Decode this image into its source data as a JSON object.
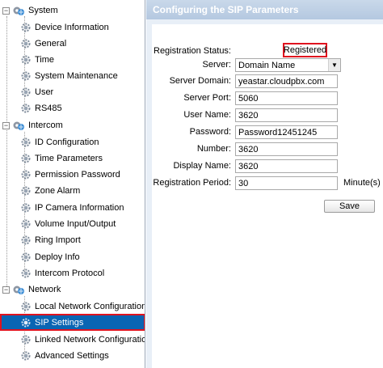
{
  "sidebar": {
    "groups": [
      {
        "label": "System",
        "icon": "gear-globe-icon",
        "items": [
          {
            "label": "Device Information",
            "icon": "gear-icon"
          },
          {
            "label": "General",
            "icon": "gear-icon"
          },
          {
            "label": "Time",
            "icon": "gear-icon"
          },
          {
            "label": "System Maintenance",
            "icon": "gear-icon"
          },
          {
            "label": "User",
            "icon": "gear-icon"
          },
          {
            "label": "RS485",
            "icon": "gear-icon"
          }
        ]
      },
      {
        "label": "Intercom",
        "icon": "gear-globe-icon",
        "items": [
          {
            "label": "ID Configuration",
            "icon": "gear-icon"
          },
          {
            "label": "Time Parameters",
            "icon": "gear-icon"
          },
          {
            "label": "Permission Password",
            "icon": "gear-icon"
          },
          {
            "label": "Zone Alarm",
            "icon": "gear-icon"
          },
          {
            "label": "IP Camera Information",
            "icon": "gear-icon"
          },
          {
            "label": "Volume Input/Output",
            "icon": "gear-icon"
          },
          {
            "label": "Ring Import",
            "icon": "gear-icon"
          },
          {
            "label": "Deploy Info",
            "icon": "gear-icon"
          },
          {
            "label": "Intercom Protocol",
            "icon": "gear-icon"
          }
        ]
      },
      {
        "label": "Network",
        "icon": "gear-globe-icon",
        "items": [
          {
            "label": "Local Network Configuration",
            "icon": "gear-icon"
          },
          {
            "label": "SIP Settings",
            "icon": "gear-icon",
            "active": true
          },
          {
            "label": "Linked Network Configuration",
            "icon": "gear-icon"
          },
          {
            "label": "Advanced Settings",
            "icon": "gear-icon"
          }
        ]
      }
    ]
  },
  "main": {
    "title": "Configuring the SIP Parameters",
    "registration_status": {
      "label": "Registration Status:",
      "value": "Registered"
    },
    "server": {
      "label": "Server:",
      "value": "Domain Name"
    },
    "server_domain": {
      "label": "Server Domain:",
      "value": "yeastar.cloudpbx.com"
    },
    "server_port": {
      "label": "Server Port:",
      "value": "5060"
    },
    "user_name": {
      "label": "User Name:",
      "value": "3620"
    },
    "password": {
      "label": "Password:",
      "value": "Password12451245"
    },
    "number": {
      "label": "Number:",
      "value": "3620"
    },
    "display_name": {
      "label": "Display Name:",
      "value": "3620"
    },
    "registration_period": {
      "label": "Registration Period:",
      "value": "30",
      "unit": "Minute(s)"
    },
    "save_label": "Save"
  },
  "colors": {
    "active_bg": "#0a65b3",
    "highlight_border": "#e0131f",
    "header_bg": "#b4c8e0"
  }
}
